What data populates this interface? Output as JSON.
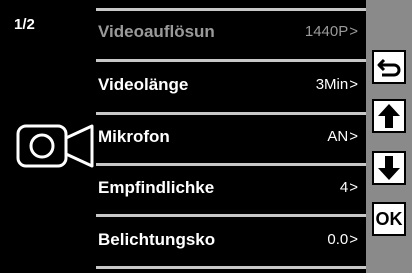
{
  "page_indicator": "1/2",
  "menu": {
    "items": [
      {
        "label": "Videoauflösun",
        "value": "1440P",
        "dimmed": true
      },
      {
        "label": "Videolänge",
        "value": "3Min",
        "dimmed": false
      },
      {
        "label": "Mikrofon",
        "value": "AN",
        "dimmed": false
      },
      {
        "label": "Empfindlichke",
        "value": "4",
        "dimmed": false
      },
      {
        "label": "Belichtungsko",
        "value": "0.0",
        "dimmed": false
      }
    ],
    "chevron": ">"
  },
  "sidebar": {
    "back_icon": "back-arrow-icon",
    "up_icon": "arrow-up-icon",
    "down_icon": "arrow-down-icon",
    "ok_label": "OK"
  },
  "mode_icon": "video-camera-icon",
  "colors": {
    "background": "#000000",
    "sidebar": "#8a8a8a",
    "separator": "#c8c8c8",
    "dimmed_text": "#9a9a9a"
  }
}
